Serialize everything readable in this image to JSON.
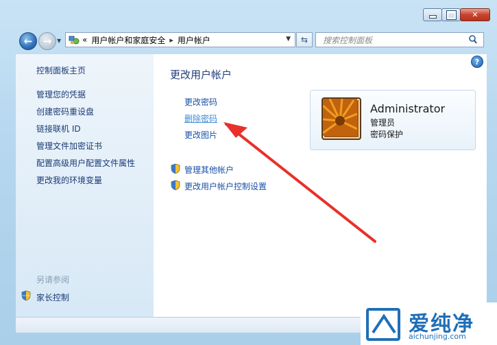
{
  "address": {
    "breadcrumb_prefix": "«",
    "parent": "用户帐户和家庭安全",
    "separator": "▸",
    "current": "用户帐户"
  },
  "search": {
    "placeholder": "搜索控制面板"
  },
  "sidebar": {
    "items": [
      {
        "label": "控制面板主页"
      },
      {
        "label": "管理您的凭据"
      },
      {
        "label": "创建密码重设盘"
      },
      {
        "label": "链接联机 ID"
      },
      {
        "label": "管理文件加密证书"
      },
      {
        "label": "配置高级用户配置文件属性"
      },
      {
        "label": "更改我的环境变量"
      }
    ],
    "see_also_label": "另请参阅",
    "see_also_items": [
      {
        "label": "家长控制"
      }
    ]
  },
  "main": {
    "heading": "更改用户帐户",
    "actions": [
      {
        "label": "更改密码"
      },
      {
        "label": "删除密码"
      },
      {
        "label": "更改图片"
      }
    ],
    "shield_actions": [
      {
        "label": "管理其他帐户"
      },
      {
        "label": "更改用户帐户控制设置"
      }
    ]
  },
  "user": {
    "name": "Administrator",
    "role": "管理员",
    "protection": "密码保护"
  },
  "watermark": {
    "text": "爱纯净",
    "url": "aichunjing.com"
  },
  "colors": {
    "link": "#1a50a6",
    "hover_link": "#3e8bd6",
    "annotation_arrow": "#e8312a"
  },
  "icons": {
    "back": "back-arrow-icon",
    "forward": "forward-arrow-icon",
    "help": "help-icon",
    "shield": "uac-shield-icon"
  }
}
